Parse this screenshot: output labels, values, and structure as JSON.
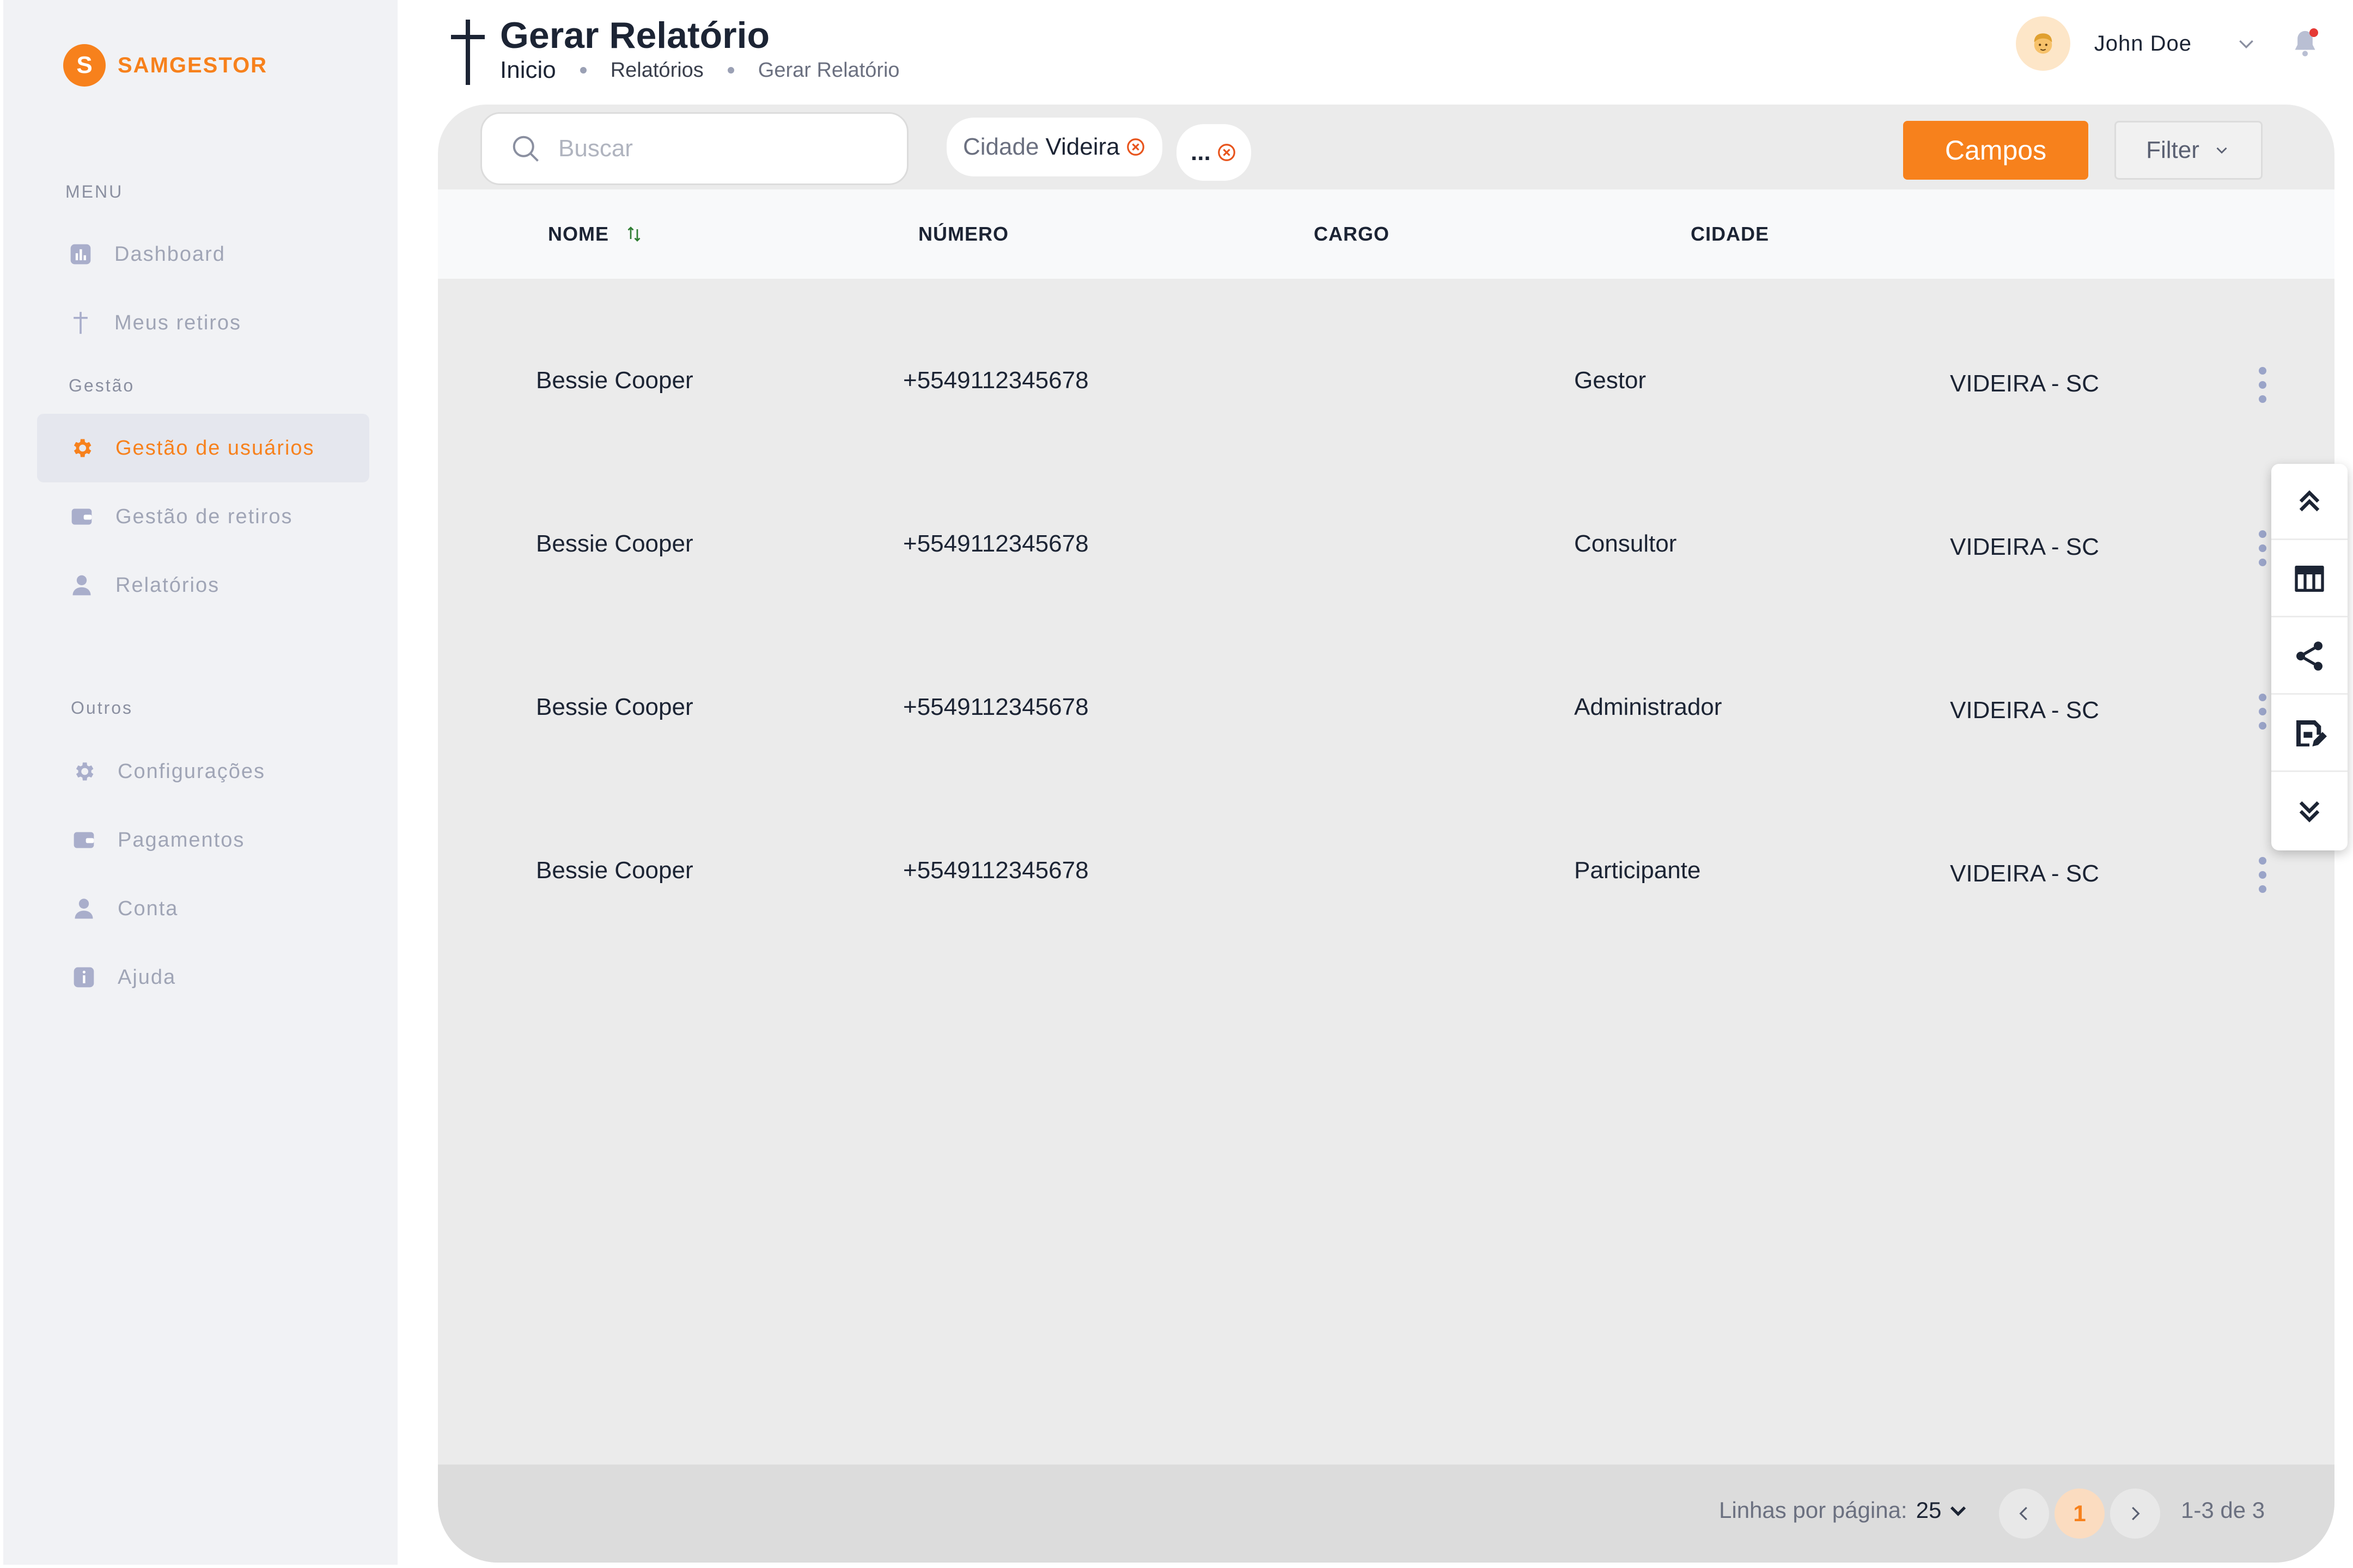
{
  "brand": {
    "initial": "S",
    "name": "SAMGESTOR"
  },
  "sidebar": {
    "menu_label": "MENU",
    "gestao_label": "Gestão",
    "outros_label": "Outros",
    "items": [
      {
        "label": "Dashboard",
        "icon": "chart-icon"
      },
      {
        "label": "Meus retiros",
        "icon": "cross-icon"
      },
      {
        "label": "Gestão de usuários",
        "icon": "gear-icon",
        "active": true
      },
      {
        "label": "Gestão de retiros",
        "icon": "wallet-icon"
      },
      {
        "label": "Relatórios",
        "icon": "user-icon"
      },
      {
        "label": "Configurações",
        "icon": "gear-icon"
      },
      {
        "label": "Pagamentos",
        "icon": "wallet-icon"
      },
      {
        "label": "Conta",
        "icon": "user-icon"
      },
      {
        "label": "Ajuda",
        "icon": "info-icon"
      }
    ]
  },
  "header": {
    "title": "Gerar Relatório",
    "breadcrumb": [
      "Inicio",
      "Relatórios",
      "Gerar Relatório"
    ],
    "user_name": "John Doe"
  },
  "toolbar": {
    "search_placeholder": "Buscar",
    "chip_key": "Cidade",
    "chip_value": "Videira",
    "chip_more": "...",
    "campos_label": "Campos",
    "filter_label": "Filter"
  },
  "table": {
    "columns": [
      "NOME",
      "NÚMERO",
      "CARGO",
      "CIDADE"
    ],
    "rows": [
      {
        "nome": "Bessie Cooper",
        "numero": "+5549112345678",
        "cargo": "Gestor",
        "cidade": "VIDEIRA - SC"
      },
      {
        "nome": "Bessie Cooper",
        "numero": "+5549112345678",
        "cargo": "Consultor",
        "cidade": "VIDEIRA - SC"
      },
      {
        "nome": "Bessie Cooper",
        "numero": "+5549112345678",
        "cargo": "Administrador",
        "cidade": "VIDEIRA - SC"
      },
      {
        "nome": "Bessie Cooper",
        "numero": "+5549112345678",
        "cargo": "Participante",
        "cidade": "VIDEIRA - SC"
      }
    ]
  },
  "pagination": {
    "rows_label": "Linhas por página:",
    "rows_value": "25",
    "current_page": "1",
    "range": "1-3 de 3"
  },
  "colors": {
    "accent": "#f7811c",
    "panel": "#ebebeb",
    "sidebar": "#f1f2f5"
  }
}
